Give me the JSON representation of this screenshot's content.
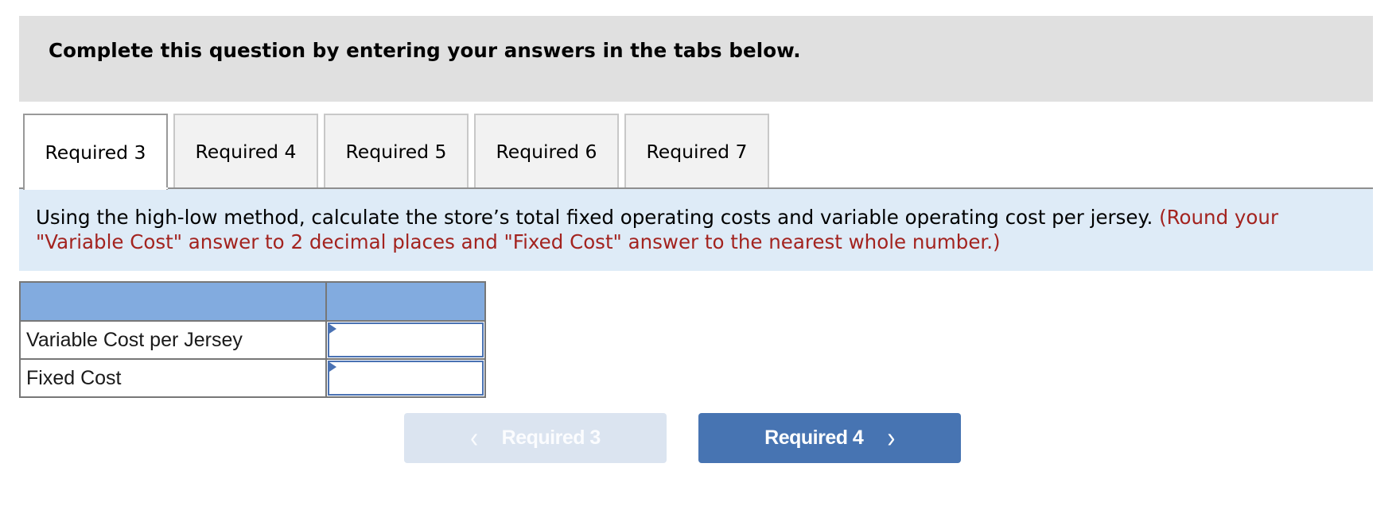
{
  "header": {
    "instruction": "Complete this question by entering your answers in the tabs below."
  },
  "tabs": [
    {
      "label": "Required 3",
      "active": true
    },
    {
      "label": "Required 4",
      "active": false
    },
    {
      "label": "Required 5",
      "active": false
    },
    {
      "label": "Required 6",
      "active": false
    },
    {
      "label": "Required 7",
      "active": false
    }
  ],
  "question": {
    "text": "Using the high-low method, calculate the store’s total fixed operating costs and variable operating cost per jersey.",
    "rounding_note": "(Round your \"Variable Cost\" answer to 2 decimal places and \"Fixed Cost\" answer to the nearest whole number.)"
  },
  "table": {
    "header": [
      "",
      ""
    ],
    "rows": [
      {
        "label": "Variable Cost per Jersey",
        "value": "",
        "placeholder": ""
      },
      {
        "label": "Fixed Cost",
        "value": "",
        "placeholder": ""
      }
    ]
  },
  "navigation": {
    "prev": {
      "label": "Required 3",
      "icon": "chevron-left-icon",
      "glyph": "‹",
      "disabled": true
    },
    "next": {
      "label": "Required 4",
      "icon": "chevron-right-icon",
      "glyph": "›",
      "disabled": false
    }
  },
  "colors": {
    "header_bg": "#e0e0e0",
    "instruction_bg": "#deebf7",
    "note_red": "#a3231f",
    "table_header_bg": "#82abdf",
    "input_border": "#4a72b3",
    "next_button": "#4774b2",
    "prev_button_disabled": "#dbe4f0"
  }
}
